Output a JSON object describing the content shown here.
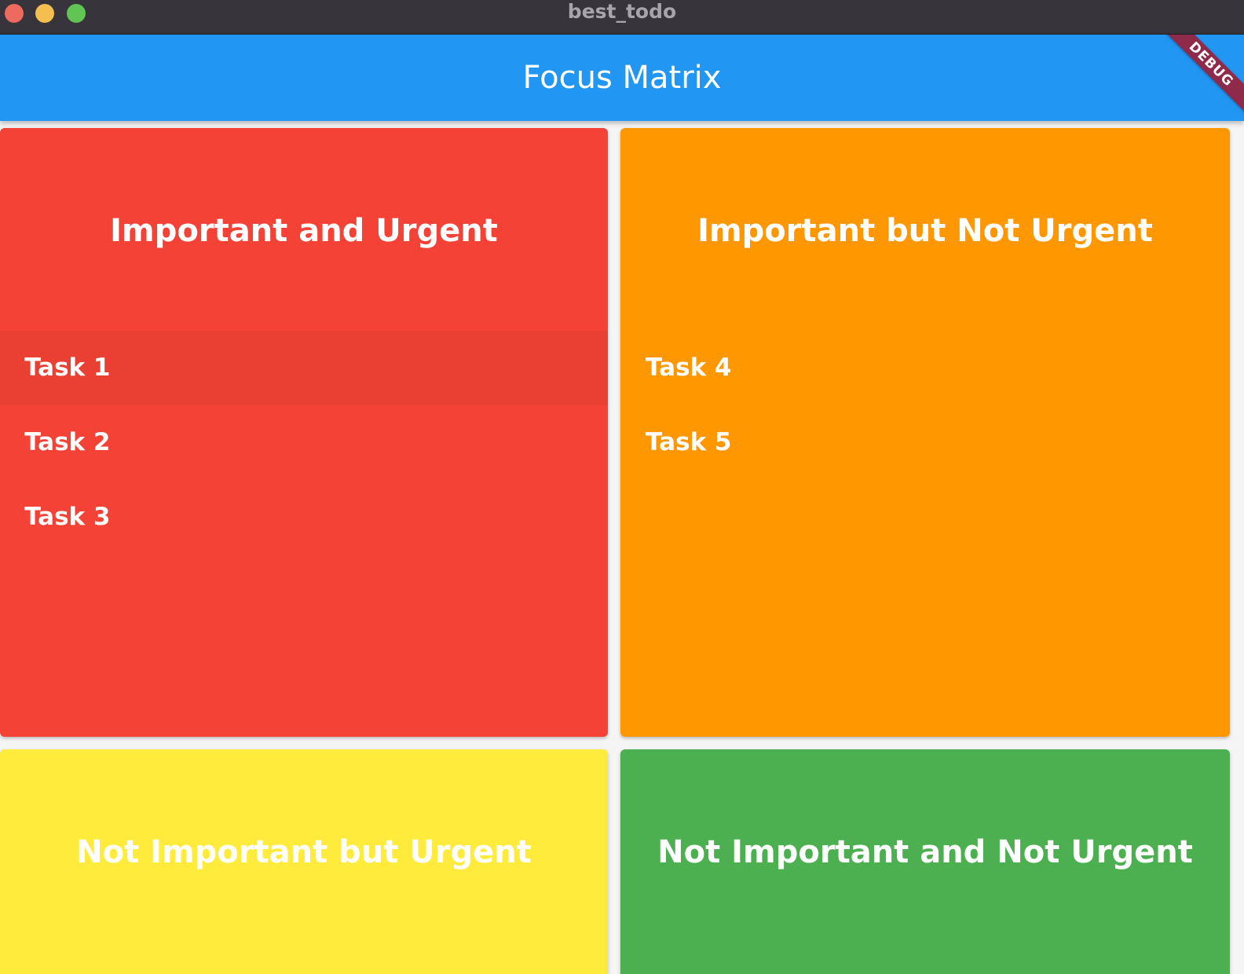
{
  "window": {
    "title": "best_todo"
  },
  "appbar": {
    "title": "Focus Matrix",
    "debug_banner": "DEBUG"
  },
  "quadrants": [
    {
      "title": "Important and Urgent",
      "color": "#f44336",
      "tasks": [
        "Task 1",
        "Task 2",
        "Task 3"
      ],
      "highlighted_task": "Task 1"
    },
    {
      "title": "Important but Not Urgent",
      "color": "#ff9800",
      "tasks": [
        "Task 4",
        "Task 5"
      ]
    },
    {
      "title": "Not Important but Urgent",
      "color": "#ffeb3b",
      "tasks": []
    },
    {
      "title": "Not Important and Not Urgent",
      "color": "#4caf50",
      "tasks": []
    }
  ],
  "colors": {
    "appbar": "#2196f3",
    "titlebar": "#37343c",
    "debug_banner": "#8f2a4a"
  }
}
